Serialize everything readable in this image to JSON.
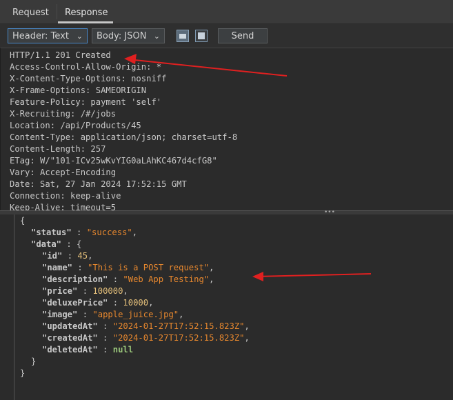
{
  "tabs": {
    "request": "Request",
    "response": "Response"
  },
  "toolbar": {
    "header_select": "Header: Text",
    "body_select": "Body: JSON",
    "send_label": "Send"
  },
  "headers": [
    "HTTP/1.1 201 Created",
    "Access-Control-Allow-Origin: *",
    "X-Content-Type-Options: nosniff",
    "X-Frame-Options: SAMEORIGIN",
    "Feature-Policy: payment 'self'",
    "X-Recruiting: /#/jobs",
    "Location: /api/Products/45",
    "Content-Type: application/json; charset=utf-8",
    "Content-Length: 257",
    "ETag: W/\"101-ICv25wKvYIG0aLAhKC467d4cfG8\"",
    "Vary: Accept-Encoding",
    "Date: Sat, 27 Jan 2024 17:52:15 GMT",
    "Connection: keep-alive",
    "Keep-Alive: timeout=5"
  ],
  "body": {
    "open": "{",
    "status_key": "\"status\"",
    "status_val": "\"success\"",
    "data_key": "\"data\"",
    "data_open": "{",
    "id_key": "\"id\"",
    "id_val": "45",
    "name_key": "\"name\"",
    "name_val": "\"This is a POST request\"",
    "description_key": "\"description\"",
    "description_val": "\"Web App Testing\"",
    "price_key": "\"price\"",
    "price_val": "100000",
    "deluxePrice_key": "\"deluxePrice\"",
    "deluxePrice_val": "10000",
    "image_key": "\"image\"",
    "image_val": "\"apple_juice.jpg\"",
    "updatedAt_key": "\"updatedAt\"",
    "updatedAt_val": "\"2024-01-27T17:52:15.823Z\"",
    "createdAt_key": "\"createdAt\"",
    "createdAt_val": "\"2024-01-27T17:52:15.823Z\"",
    "deletedAt_key": "\"deletedAt\"",
    "deletedAt_val": "null",
    "data_close": "}",
    "close": "}"
  },
  "colors": {
    "annotation_arrow": "#e02020",
    "string": "#e8882e",
    "number": "#e5c07b",
    "null": "#98c379"
  }
}
